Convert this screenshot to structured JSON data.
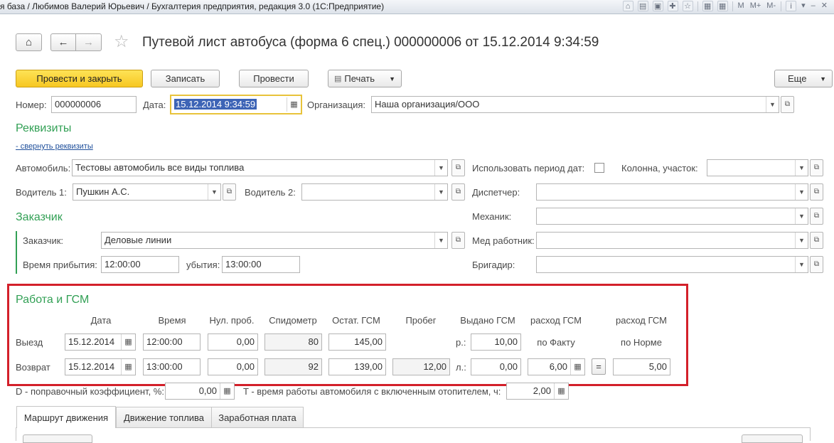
{
  "window": {
    "title": "я база / Любимов Валерий Юрьевич / Бухгалтерия предприятия, редакция 3.0  (1С:Предприятие)",
    "toolbar_icons": [
      "home-screen-icon",
      "print-icon",
      "preview-icon",
      "favorites-add-icon",
      "favorites-icon",
      "calculator-icon",
      "calendar-icon"
    ],
    "memory_buttons": [
      "M",
      "M+",
      "M-"
    ],
    "info_icon": "i",
    "menu_icon": "▾",
    "minimize_icon": "–",
    "close_icon": "✕"
  },
  "header": {
    "title": "Путевой лист автобуса (форма 6 спец.) 000000006 от 15.12.2014 9:34:59",
    "home_icon": "⌂",
    "back_icon": "←",
    "forward_icon": "→",
    "favorite_icon": "☆"
  },
  "toolbar": {
    "post_and_close": "Провести и закрыть",
    "save": "Записать",
    "post": "Провести",
    "print": "Печать",
    "more": "Еще"
  },
  "fields": {
    "number_label": "Номер:",
    "number_value": "000000006",
    "date_label": "Дата:",
    "date_value": "15.12.2014  9:34:59",
    "org_label": "Организация:",
    "org_value": "Наша организация/ООО"
  },
  "requisites": {
    "title": "Реквизиты",
    "collapse_link": "- свернуть реквизиты",
    "car_label": "Автомобиль:",
    "car_value": "Тестовы автомобиль все виды топлива",
    "use_period_label": "Использовать период дат:",
    "use_period_checked": false,
    "column_label": "Колонна, участок:",
    "column_value": "",
    "driver1_label": "Водитель 1:",
    "driver1_value": "Пушкин А.С.",
    "driver2_label": "Водитель 2:",
    "driver2_value": "",
    "dispatcher_label": "Диспетчер:",
    "dispatcher_value": "",
    "mechanic_label": "Механик:",
    "mechanic_value": "",
    "medic_label": "Мед работник:",
    "medic_value": "",
    "foreman_label": "Бригадир:",
    "foreman_value": ""
  },
  "customer": {
    "title": "Заказчик",
    "customer_label": "Заказчик:",
    "customer_value": "Деловые линии",
    "arrival_label": "Время прибытия:",
    "arrival_value": "12:00:00",
    "departure_label": "убытия:",
    "departure_value": "13:00:00"
  },
  "work": {
    "title": "Работа и ГСМ",
    "headers": {
      "date": "Дата",
      "time": "Время",
      "zero": "Нул. проб.",
      "speedometer": "Спидометр",
      "fuel_left": "Остат. ГСМ",
      "mileage": "Пробег",
      "issued": "Выдано ГСМ",
      "consumption_fact": "расход ГСМ",
      "consumption_fact_sub": "по Факту",
      "consumption_norm": "расход ГСМ",
      "consumption_norm_sub": "по Норме"
    },
    "departure": {
      "label": "Выезд",
      "date": "15.12.2014",
      "time": "12:00:00",
      "zero": "0,00",
      "speedometer": "80",
      "fuel_left": "145,00",
      "issued_unit": "р.:",
      "issued": "10,00"
    },
    "return": {
      "label": "Возврат",
      "date": "15.12.2014",
      "time": "13:00:00",
      "zero": "0,00",
      "speedometer": "92",
      "fuel_left": "139,00",
      "mileage": "12,00",
      "issued_unit": "л.:",
      "issued": "0,00",
      "fact": "6,00",
      "equals": "=",
      "norm": "5,00"
    }
  },
  "coefficients": {
    "d_label": "D - поправочный коэффициент, %:",
    "d_value": "0,00",
    "t_label": "T - время работы автомобиля с включенным отопителем, ч:",
    "t_value": "2,00"
  },
  "tabs": [
    {
      "label": "Маршрут движения",
      "active": true
    },
    {
      "label": "Движение топлива",
      "active": false
    },
    {
      "label": "Заработная плата",
      "active": false
    }
  ],
  "colors": {
    "accent_green": "#32a055",
    "primary_yellow": "#f7c722",
    "highlight_red": "#d3202a",
    "focus_border": "#e8c33b",
    "selection_blue": "#3d64b6"
  }
}
